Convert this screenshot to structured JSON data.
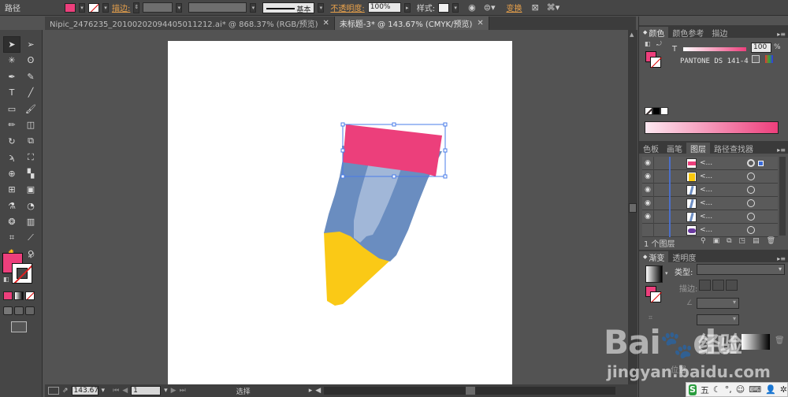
{
  "control_bar": {
    "object_type": "路径",
    "stroke_label": "描边:",
    "stroke_style_label": "基本",
    "opacity_label": "不透明度:",
    "opacity_value": "100%",
    "style_label": "样式:",
    "transform_label": "变换",
    "fill_color": "#ed3f7c"
  },
  "tabs": [
    {
      "label": "Nipic_2476235_20100202094405011212.ai* @ 868.37% (RGB/预览)",
      "active": false
    },
    {
      "label": "未标题-3* @ 143.67% (CMYK/预览)",
      "active": true
    }
  ],
  "toolbox": {
    "tools": [
      "selection-tool",
      "direct-selection-tool",
      "magic-wand-tool",
      "lasso-tool",
      "pen-tool",
      "curvature-tool",
      "type-tool",
      "line-tool",
      "rectangle-tool",
      "paintbrush-tool",
      "pencil-tool",
      "eraser-tool",
      "rotate-tool",
      "scale-tool",
      "warp-tool",
      "free-transform-tool",
      "shape-builder-tool",
      "perspective-grid-tool",
      "mesh-tool",
      "gradient-tool",
      "eyedropper-tool",
      "blend-tool",
      "symbol-sprayer-tool",
      "column-graph-tool",
      "artboard-tool",
      "slice-tool",
      "hand-tool",
      "zoom-tool"
    ],
    "fill_color": "#ed3f7c"
  },
  "statusbar": {
    "zoom": "143.67",
    "page": "1",
    "status": "选择"
  },
  "color_panel": {
    "tabs": [
      "颜色",
      "颜色参考",
      "描边"
    ],
    "tint_label": "T",
    "tint_value": "100",
    "tint_unit": "%",
    "swatch_name": "PANTONE DS 141-4 C",
    "color": "#ed3f7c"
  },
  "layers_panel": {
    "tabs": [
      "色板",
      "画笔",
      "图层",
      "路径查找器"
    ],
    "rows": [
      {
        "name": "<...",
        "color": "#ed3f7c"
      },
      {
        "name": "<...",
        "color": "#f9c80e"
      },
      {
        "name": "<...",
        "color": "#6e8fc4"
      },
      {
        "name": "<...",
        "color": "#6e8fc4"
      },
      {
        "name": "<...",
        "color": "#6e8fc4"
      },
      {
        "name": "<...",
        "color": "#6a3aa0"
      }
    ],
    "footer": "1 个图层"
  },
  "gradient_panel": {
    "tabs": [
      "渐变",
      "透明度"
    ],
    "type_label": "类型:",
    "stroke_label": "描边:",
    "position_label": "位置"
  },
  "watermark": {
    "brand": "Bai",
    "brand2": "du",
    "cn": "经验",
    "url": "jingyan.baidu.com"
  },
  "ime": {
    "logo": "S",
    "mode": "五"
  }
}
